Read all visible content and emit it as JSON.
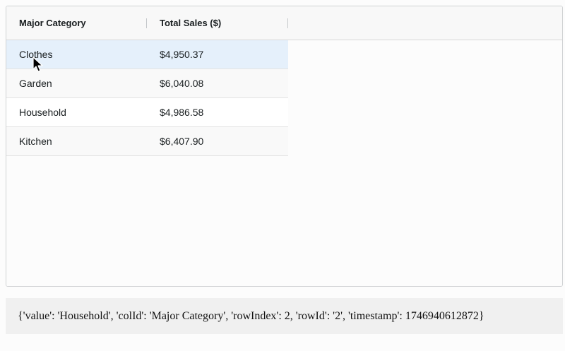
{
  "grid": {
    "columns": [
      {
        "header": "Major Category"
      },
      {
        "header": "Total Sales ($)"
      }
    ],
    "rows": [
      {
        "category": "Clothes",
        "sales": "$4,950.37"
      },
      {
        "category": "Garden",
        "sales": "$6,040.08"
      },
      {
        "category": "Household",
        "sales": "$4,986.58"
      },
      {
        "category": "Kitchen",
        "sales": "$6,407.90"
      }
    ]
  },
  "event_output": "{'value': 'Household', 'colId': 'Major Category', 'rowIndex': 2, 'rowId': '2', 'timestamp': 1746940612872}",
  "icons": {
    "cursor": "mouse-pointer-icon"
  },
  "colors": {
    "hover_row": "#e5f0fb",
    "header_bg": "#f8f8f8"
  }
}
